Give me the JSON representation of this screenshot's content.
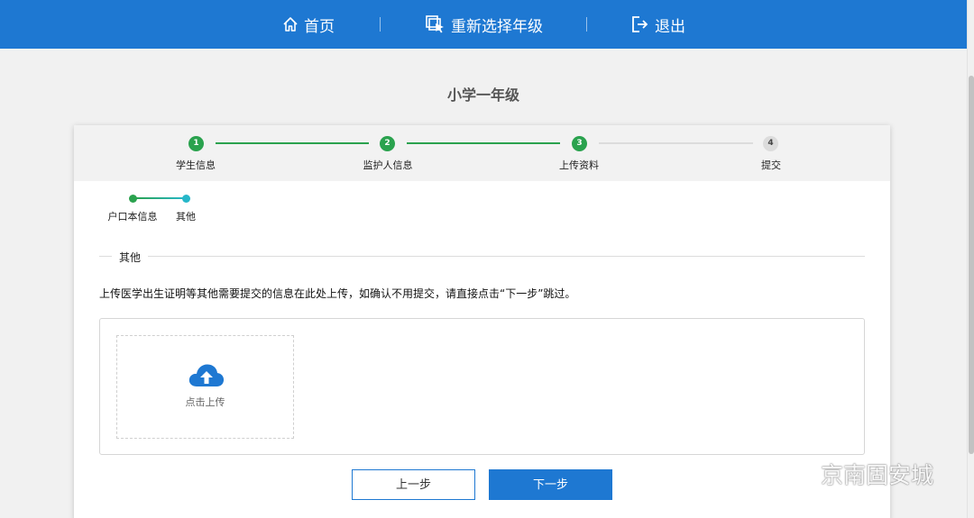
{
  "nav": {
    "home": "首页",
    "reselect_grade": "重新选择年级",
    "logout": "退出"
  },
  "page": {
    "title": "小学一年级"
  },
  "steps": [
    {
      "num": "1",
      "label": "学生信息",
      "status": "done"
    },
    {
      "num": "2",
      "label": "监护人信息",
      "status": "done"
    },
    {
      "num": "3",
      "label": "上传资料",
      "status": "done"
    },
    {
      "num": "4",
      "label": "提交",
      "status": "todo"
    }
  ],
  "substeps": [
    {
      "label": "户口本信息"
    },
    {
      "label": "其他"
    }
  ],
  "section": {
    "title": "其他",
    "instruction": "上传医学出生证明等其他需要提交的信息在此处上传，如确认不用提交，请直接点击“下一步”跳过。"
  },
  "upload": {
    "label": "点击上传"
  },
  "buttons": {
    "prev": "上一步",
    "next": "下一步"
  },
  "watermark": {
    "text": "京南固安城",
    "icon": "wechat-icon"
  },
  "colors": {
    "primary": "#1e78d2",
    "success": "#2aa24e",
    "accent": "#26b7c9"
  }
}
